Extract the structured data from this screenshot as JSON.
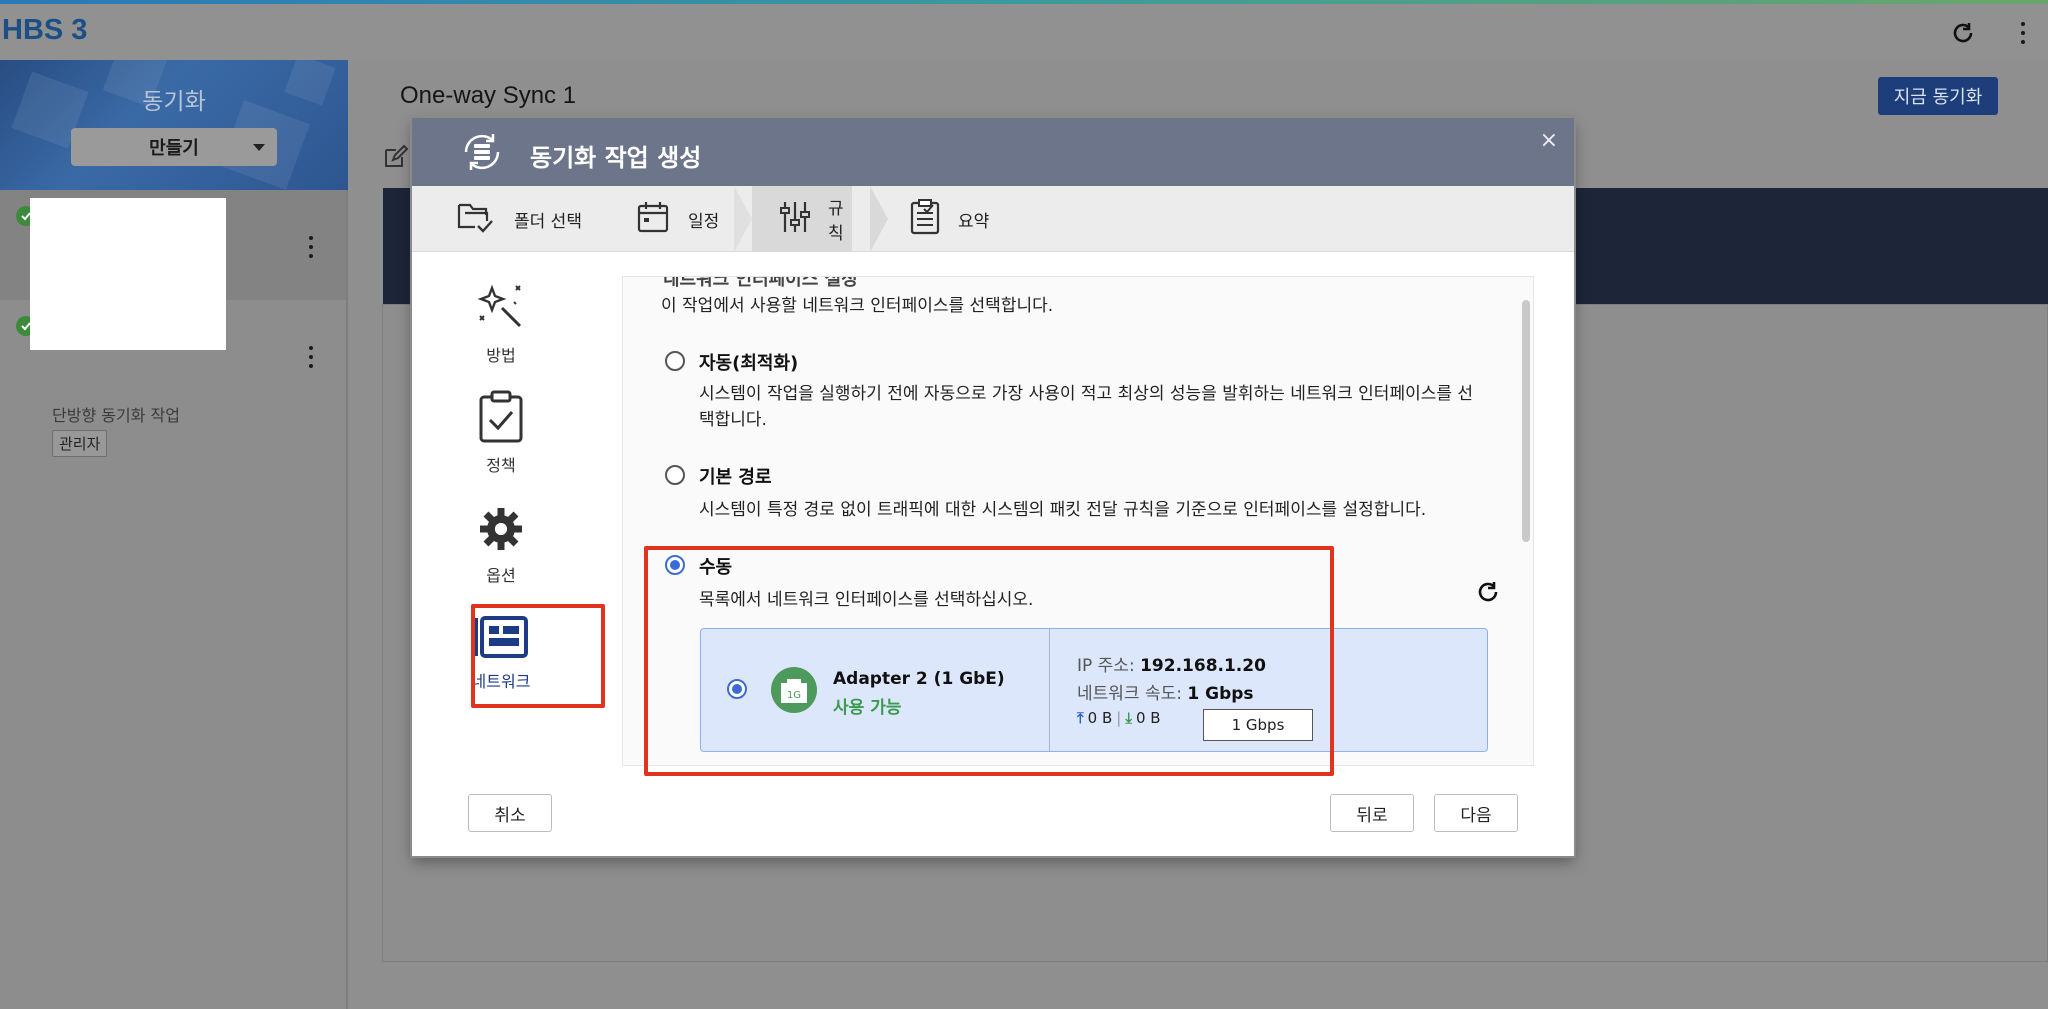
{
  "app": {
    "title": "HBS 3"
  },
  "sidebar": {
    "title": "동기화",
    "create_button": "만들기",
    "jobs": [
      {
        "name": "",
        "status": "ok"
      },
      {
        "name": "단방향 동기화 작업",
        "badge": "관리자",
        "status": "ok"
      }
    ]
  },
  "main": {
    "title": "One-way Sync 1",
    "sync_now_button": "지금 동기화"
  },
  "dialog": {
    "title": "동기화 작업 생성",
    "close": "×",
    "steps": [
      {
        "label": "폴더 선택",
        "icon": "folder-select-icon"
      },
      {
        "label": "일정",
        "icon": "calendar-icon"
      },
      {
        "label": "규칙",
        "icon": "sliders-icon",
        "active": true
      },
      {
        "label": "요약",
        "icon": "clipboard-icon"
      }
    ],
    "side_nav": [
      {
        "label": "방법",
        "icon": "magic-wand-icon"
      },
      {
        "label": "정책",
        "icon": "clipboard-check-icon"
      },
      {
        "label": "옵션",
        "icon": "gear-icon"
      },
      {
        "label": "네트워크",
        "icon": "network-icon",
        "active": true
      }
    ],
    "section_title": "네트워크 인터페이스 설정",
    "section_desc": "이 작업에서 사용할 네트워크 인터페이스를 선택합니다.",
    "options": [
      {
        "title": "자동(최적화)",
        "desc": "시스템이 작업을 실행하기 전에 자동으로 가장 사용이 적고 최상의 성능을 발휘하는 네트워크 인터페이스를 선택합니다.",
        "selected": false
      },
      {
        "title": "기본 경로",
        "desc": "시스템이 특정 경로 없이 트래픽에 대한 시스템의 패킷 전달 규칙을 기준으로 인터페이스를 설정합니다.",
        "selected": false
      },
      {
        "title": "수동",
        "desc": "목록에서 네트워크 인터페이스를 선택하십시오.",
        "selected": true
      }
    ],
    "adapter": {
      "badge": "1G",
      "name": "Adapter 2 (1 GbE)",
      "status": "사용 가능",
      "ip_label": "IP 주소:",
      "ip": "192.168.1.20",
      "speed_label": "네트워크 속도:",
      "speed": "1 Gbps",
      "upload": "0 B",
      "download": "0 B",
      "separator": "|",
      "limit_value": "1 Gbps"
    },
    "buttons": {
      "cancel": "취소",
      "back": "뒤로",
      "next": "다음"
    }
  },
  "colors": {
    "accent": "#3b6cd6",
    "header": "#6c7589",
    "available": "#3b9a4e",
    "highlight": "#e0341f",
    "primary_button": "#1d3e7a"
  }
}
